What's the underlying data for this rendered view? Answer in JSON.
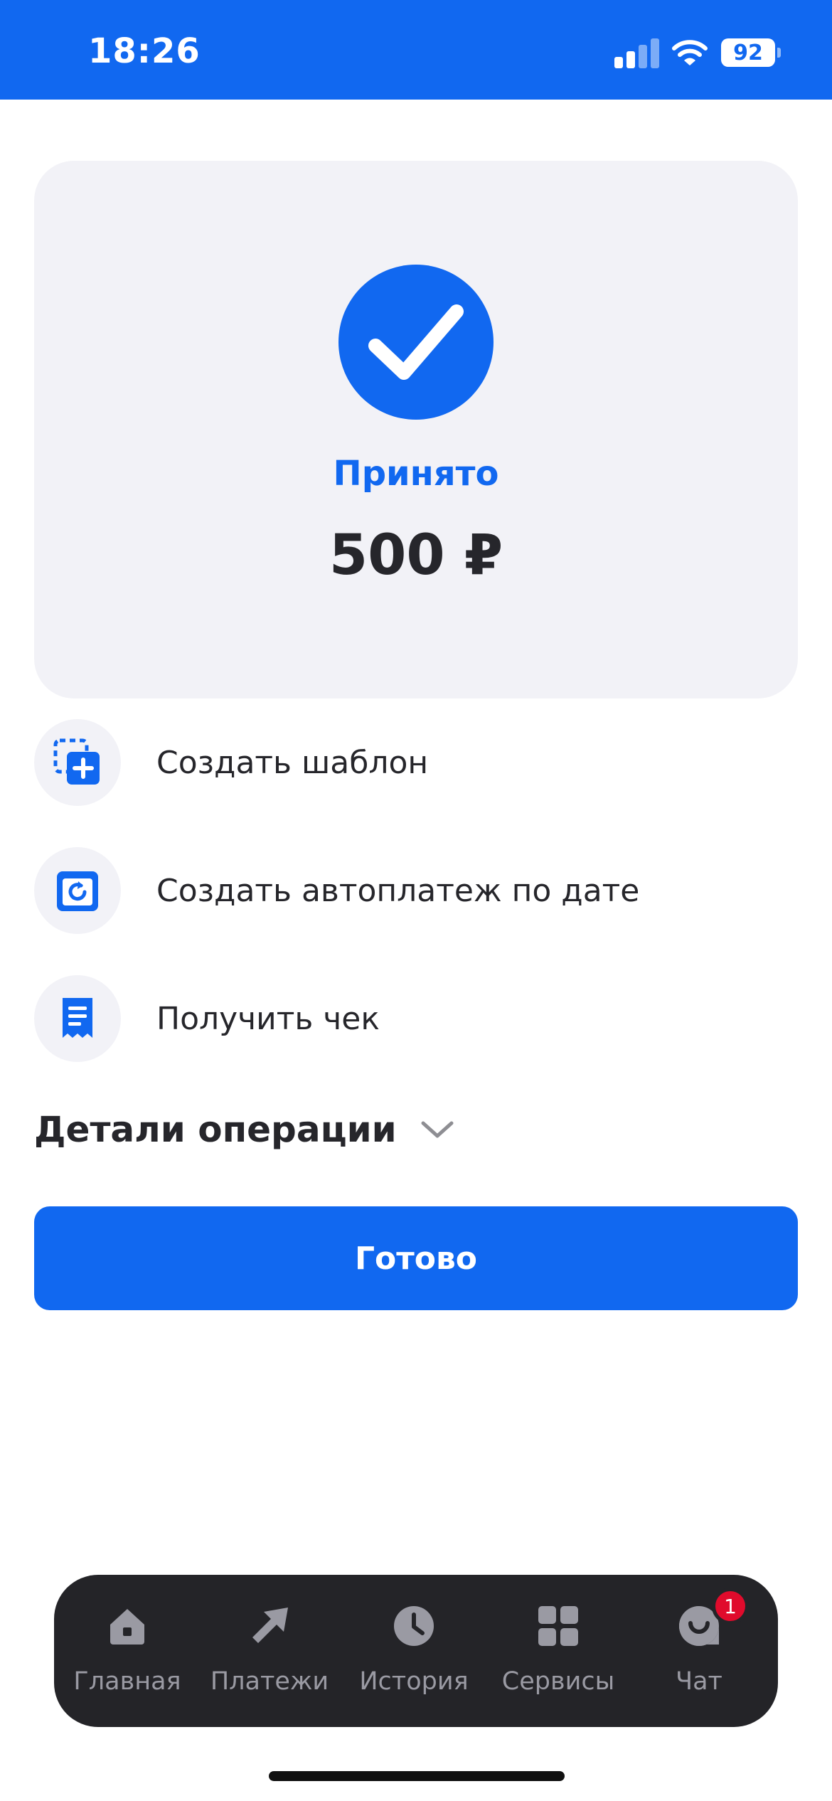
{
  "status_bar": {
    "time": "18:26",
    "battery_level": "92",
    "background": "#1168f0"
  },
  "result": {
    "status": "Принято",
    "amount": "500 ₽",
    "icon": "checkmark-icon"
  },
  "actions": [
    {
      "label": "Создать шаблон",
      "icon": "template-add-icon"
    },
    {
      "label": "Создать автоплатеж по дате",
      "icon": "autopay-calendar-icon"
    },
    {
      "label": "Получить чек",
      "icon": "receipt-icon"
    }
  ],
  "details": {
    "title": "Детали операции",
    "icon": "chevron-down-icon"
  },
  "done_button": {
    "label": "Готово",
    "color": "#1168f0"
  },
  "tab_bar": {
    "items": [
      {
        "label": "Главная",
        "icon": "home-icon"
      },
      {
        "label": "Платежи",
        "icon": "payments-arrow-icon"
      },
      {
        "label": "История",
        "icon": "clock-icon"
      },
      {
        "label": "Сервисы",
        "icon": "grid-icon"
      },
      {
        "label": "Чат",
        "icon": "chat-icon",
        "badge": "1"
      }
    ]
  },
  "colors": {
    "accent": "#1168f0",
    "card_background": "#f2f2f7",
    "tab_bar_background": "#242428",
    "badge": "#e00b2c"
  }
}
